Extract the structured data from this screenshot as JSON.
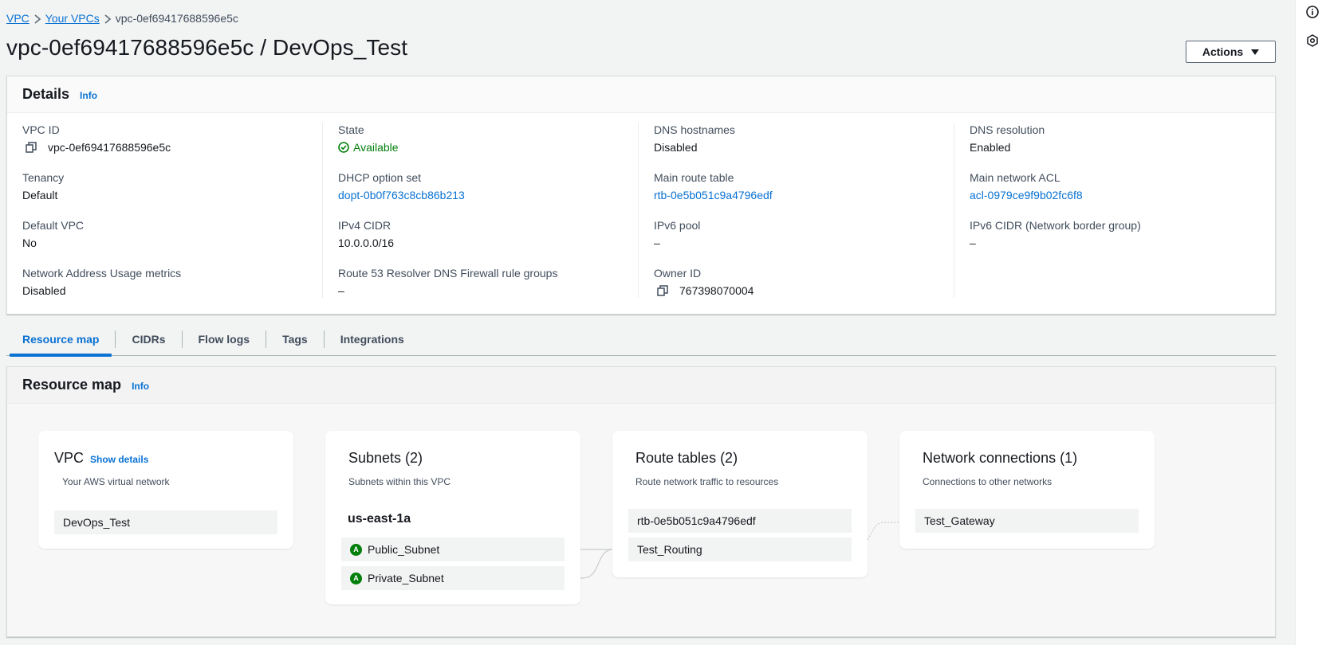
{
  "breadcrumb": {
    "vpc": "VPC",
    "your_vpcs": "Your VPCs",
    "current": "vpc-0ef69417688596e5c"
  },
  "page_title": "vpc-0ef69417688596e5c / DevOps_Test",
  "actions_label": "Actions",
  "details": {
    "title": "Details",
    "info": "Info",
    "columns": [
      [
        {
          "label": "VPC ID",
          "value": "vpc-0ef69417688596e5c",
          "icon": "copy-icon"
        },
        {
          "label": "Tenancy",
          "value": "Default"
        },
        {
          "label": "Default VPC",
          "value": "No"
        },
        {
          "label": "Network Address Usage metrics",
          "value": "Disabled"
        }
      ],
      [
        {
          "label": "State",
          "value": "Available",
          "icon": "check-circle-icon"
        },
        {
          "label": "DHCP option set",
          "value": "dopt-0b0f763c8cb86b213"
        },
        {
          "label": "IPv4 CIDR",
          "value": "10.0.0.0/16"
        },
        {
          "label": "Route 53 Resolver DNS Firewall rule groups",
          "value": "–"
        }
      ],
      [
        {
          "label": "DNS hostnames",
          "value": "Disabled"
        },
        {
          "label": "Main route table",
          "value": "rtb-0e5b051c9a4796edf"
        },
        {
          "label": "IPv6 pool",
          "value": "–"
        },
        {
          "label": "Owner ID",
          "value": "767398070004",
          "icon": "copy-icon"
        }
      ],
      [
        {
          "label": "DNS resolution",
          "value": "Enabled"
        },
        {
          "label": "Main network ACL",
          "value": "acl-0979ce9f9b02fc6f8"
        },
        {
          "label": "IPv6 CIDR (Network border group)",
          "value": "–"
        }
      ]
    ]
  },
  "tabs": [
    "Resource map",
    "CIDRs",
    "Flow logs",
    "Tags",
    "Integrations"
  ],
  "resource_map": {
    "title": "Resource map",
    "info": "Info",
    "vpc_card": {
      "title": "VPC",
      "show_details": "Show details",
      "subtitle": "Your AWS virtual network",
      "item": "DevOps_Test"
    },
    "subnets_card": {
      "title": "Subnets (2)",
      "subtitle": "Subnets within this VPC",
      "az": "us-east-1a",
      "items": [
        "Public_Subnet",
        "Private_Subnet"
      ],
      "badge": "A"
    },
    "routes_card": {
      "title": "Route tables (2)",
      "subtitle": "Route network traffic to resources",
      "items": [
        "rtb-0e5b051c9a4796edf",
        "Test_Routing"
      ]
    },
    "network_card": {
      "title": "Network connections (1)",
      "subtitle": "Connections to other networks",
      "items": [
        "Test_Gateway"
      ]
    }
  },
  "colors": {
    "link": "#0972d3",
    "success": "#037f0c",
    "text": "#16191f",
    "background": "#f2f3f3"
  }
}
